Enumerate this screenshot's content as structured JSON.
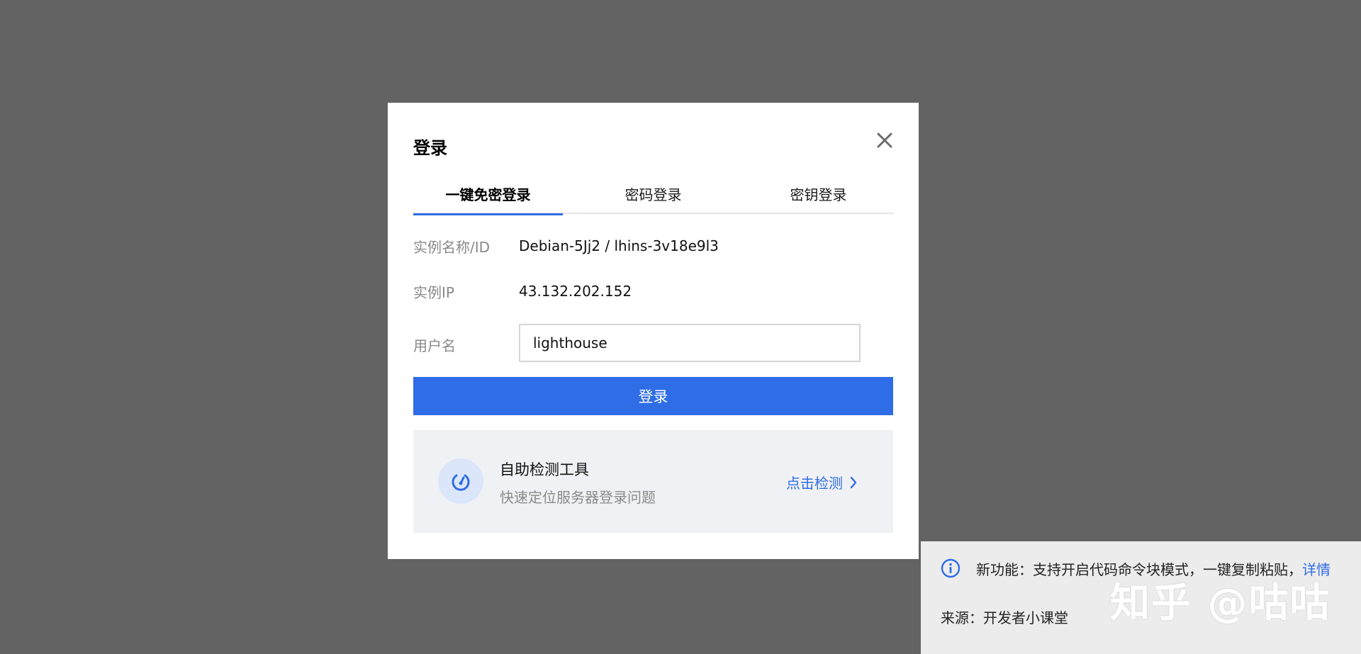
{
  "modal": {
    "title": "登录",
    "tabs": [
      {
        "label": "一键免密登录",
        "active": true
      },
      {
        "label": "密码登录",
        "active": false
      },
      {
        "label": "密钥登录",
        "active": false
      }
    ],
    "fields": {
      "instance_name_label": "实例名称/ID",
      "instance_name_value": "Debian-5Jj2 / lhins-3v18e9l3",
      "instance_ip_label": "实例IP",
      "instance_ip_value": "43.132.202.152",
      "username_label": "用户名",
      "username_value": "lighthouse"
    },
    "login_button": "登录",
    "diagnostic": {
      "title": "自助检测工具",
      "subtitle": "快速定位服务器登录问题",
      "link": "点击检测"
    }
  },
  "notice": {
    "text": "新功能：支持开启代码命令块模式，一键复制粘贴，",
    "detail_link": "详情",
    "source": "来源：开发者小课堂"
  },
  "watermark": "知乎 @咕咕",
  "colors": {
    "accent": "#2f6de6",
    "overlay": "#636363"
  }
}
